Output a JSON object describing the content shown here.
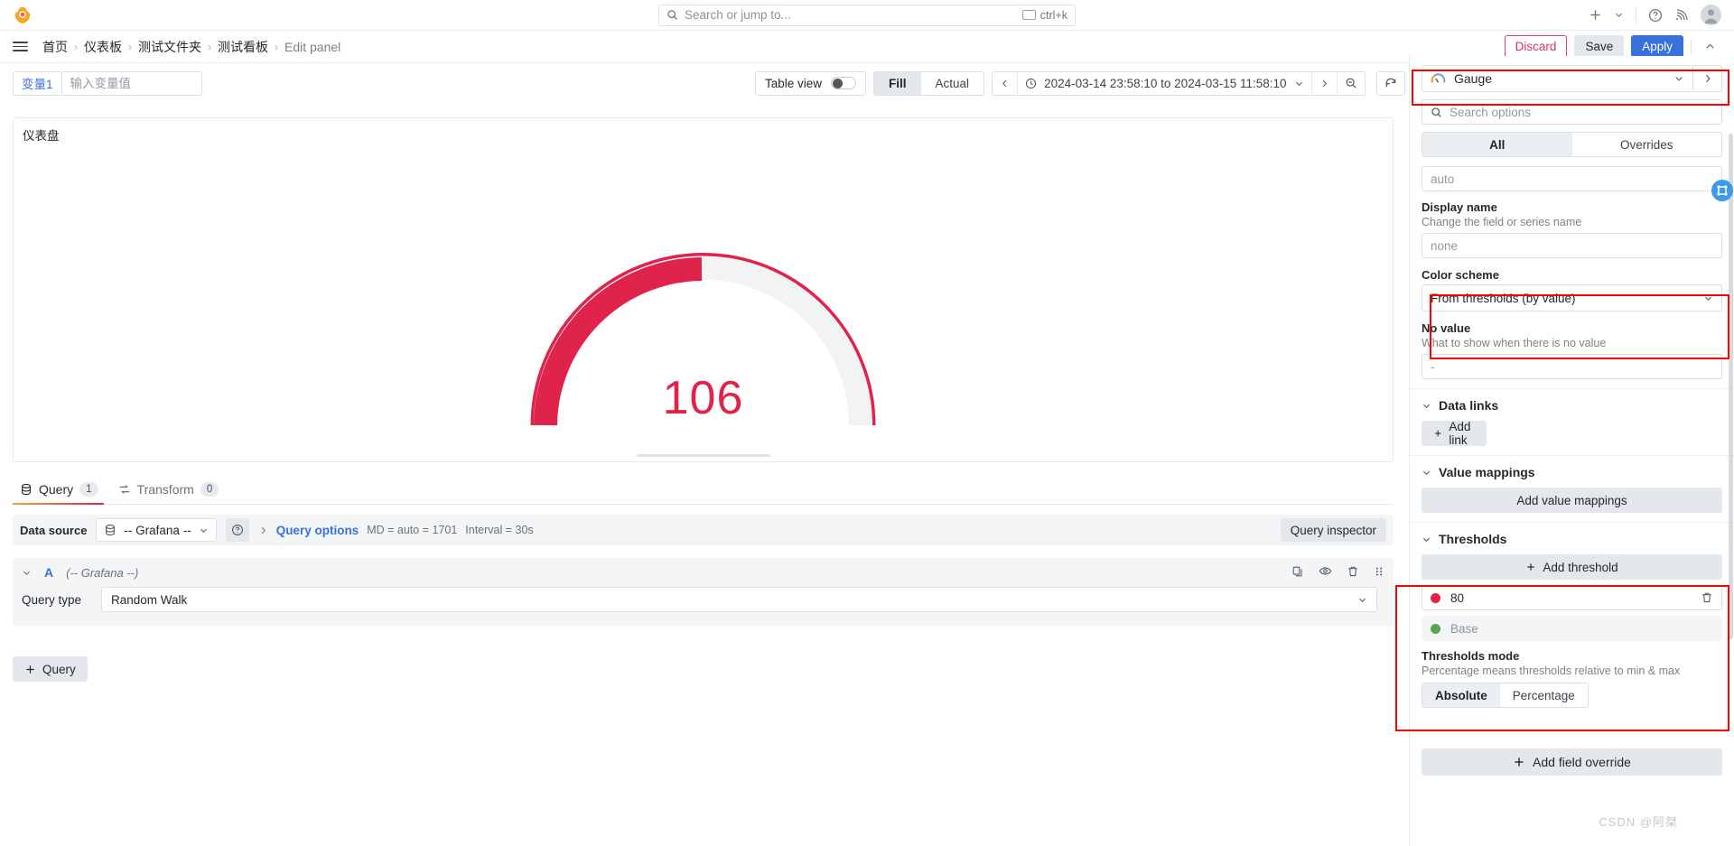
{
  "topnav": {
    "logo_icon": "grafana-logo",
    "search": {
      "placeholder": "Search or jump to...",
      "shortcut": "ctrl+k",
      "icon": "search-icon"
    },
    "add_icon": "plus-icon",
    "help_icon": "question-circle-icon",
    "news_icon": "rss-feed-icon",
    "avatar_icon": "user-avatar"
  },
  "breadcrumb": {
    "menu_icon": "hamburger-menu-icon",
    "items": [
      "首页",
      "仪表板",
      "测试文件夹",
      "测试看板",
      "Edit panel"
    ],
    "separator": "›"
  },
  "actions": {
    "discard": "Discard",
    "save": "Save",
    "apply": "Apply",
    "collapse_icon": "chevron-up-icon"
  },
  "toolbar": {
    "variable_label": "变量1",
    "variable_placeholder": "输入变量值",
    "variable_value": "",
    "table_view_label": "Table view",
    "table_view_on": false,
    "fill_actual": {
      "options": [
        "Fill",
        "Actual"
      ],
      "selected": "Fill"
    },
    "time_prev_icon": "chevron-left-icon",
    "time_next_icon": "chevron-right-icon",
    "clock_icon": "clock-icon",
    "time_range": "2024-03-14 23:58:10 to 2024-03-15 11:58:10",
    "zoom_out_icon": "zoom-out-icon",
    "refresh_icon": "refresh-icon"
  },
  "panel": {
    "title": "仪表盘",
    "gauge_value": "106"
  },
  "chart_data": {
    "type": "gauge",
    "title": "仪表盘",
    "value": 106,
    "min": 0,
    "max": 260,
    "fill_fraction": 0.41,
    "value_color": "#e0234a",
    "track_color": "#f2f3f5",
    "threshold_ring_color": "#e0234a",
    "thresholds": [
      {
        "label": "Base",
        "value": "Base",
        "color": "#56a64b"
      },
      {
        "label": "80",
        "value": 80,
        "color": "#e0234a"
      }
    ],
    "color_scheme": "From thresholds (by value)"
  },
  "query_pane": {
    "tabs": [
      {
        "label": "Query",
        "count": "1",
        "icon": "database-icon",
        "active": true
      },
      {
        "label": "Transform",
        "count": "0",
        "icon": "transform-icon",
        "active": false
      }
    ],
    "data_source_label": "Data source",
    "data_source_value": "-- Grafana --",
    "data_source_icon": "database-icon",
    "help_icon": "question-circle-icon",
    "query_options_label": "Query options",
    "query_options_expand_icon": "chevron-right-icon",
    "md_text": "MD = auto = 1701",
    "interval_text": "Interval = 30s",
    "query_inspector": "Query inspector",
    "query_row": {
      "collapse_icon": "chevron-down-icon",
      "letter": "A",
      "datasource": "(-- Grafana --)",
      "copy_icon": "copy-icon",
      "hide_icon": "eye-icon",
      "delete_icon": "trash-icon",
      "drag_icon": "drag-handle-icon",
      "query_type_label": "Query type",
      "query_type_value": "Random Walk",
      "chevron_icon": "chevron-down-icon"
    },
    "add_query_label": "Query",
    "add_query_icon": "plus-icon"
  },
  "options": {
    "viz_name": "Gauge",
    "viz_icon": "gauge-icon",
    "viz_chevron_icon": "chevron-down-icon",
    "viz_next_icon": "chevron-right-icon",
    "search_placeholder": "Search options",
    "search_icon": "search-icon",
    "tabs": {
      "options": [
        "All",
        "Overrides"
      ],
      "selected": "All"
    },
    "auto_field_placeholder": "auto",
    "display_name": {
      "label": "Display name",
      "description": "Change the field or series name",
      "placeholder": "none"
    },
    "color_scheme": {
      "label": "Color scheme",
      "value": "From thresholds (by value)"
    },
    "no_value": {
      "label": "No value",
      "description": "What to show when there is no value",
      "placeholder": "-"
    },
    "data_links": {
      "label": "Data links",
      "add_label": "Add link",
      "add_icon": "plus-icon"
    },
    "value_mappings": {
      "label": "Value mappings",
      "add_label": "Add value mappings"
    },
    "thresholds": {
      "label": "Thresholds",
      "add_label": "Add threshold",
      "add_icon": "plus-icon",
      "rows": [
        {
          "color": "#e0234a",
          "value": "80",
          "delete_icon": "trash-icon",
          "muted": false
        },
        {
          "color": "#56a64b",
          "value": "Base",
          "delete_icon": "",
          "muted": true
        }
      ],
      "mode_label": "Thresholds mode",
      "mode_description": "Percentage means thresholds relative to min & max",
      "mode_options": [
        "Absolute",
        "Percentage"
      ],
      "mode_selected": "Absolute"
    },
    "add_field_override": "Add field override",
    "add_field_override_icon": "plus-icon"
  },
  "watermark": "CSDN @阿桀",
  "colors": {
    "accent_blue": "#3871dc",
    "danger_red": "#e0234a",
    "annotation_red": "#ff0000",
    "success_green": "#56a64b"
  }
}
